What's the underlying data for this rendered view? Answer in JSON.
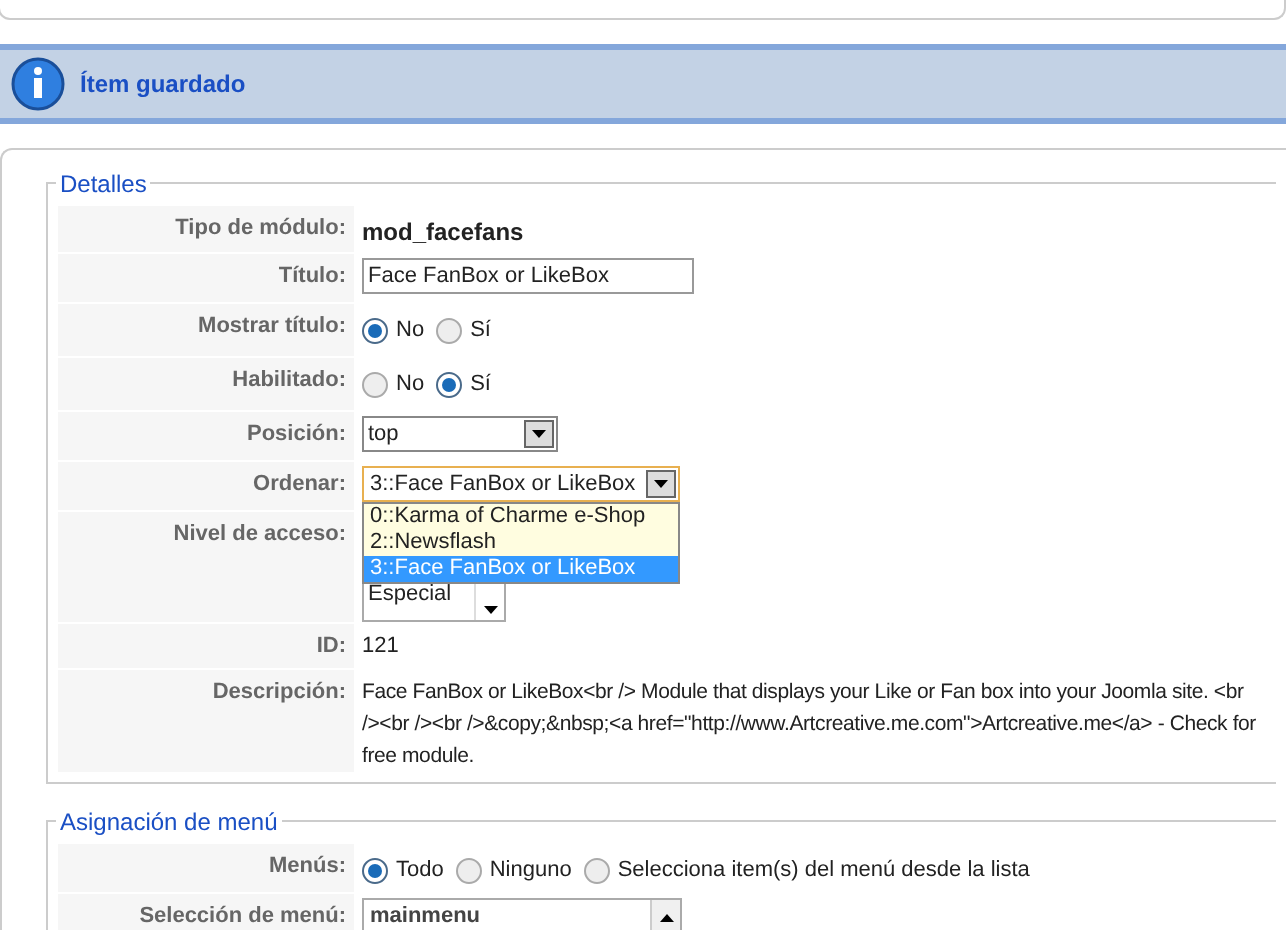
{
  "message": {
    "text": "Ítem guardado"
  },
  "details": {
    "legend": "Detalles",
    "module_type": {
      "label": "Tipo de módulo:",
      "value": "mod_facefans"
    },
    "title": {
      "label": "Título:",
      "value": "Face FanBox or LikeBox"
    },
    "show_title": {
      "label": "Mostrar título:",
      "options": [
        {
          "label": "No",
          "selected": true
        },
        {
          "label": "Sí",
          "selected": false
        }
      ]
    },
    "enabled": {
      "label": "Habilitado:",
      "options": [
        {
          "label": "No",
          "selected": false
        },
        {
          "label": "Sí",
          "selected": true
        }
      ]
    },
    "position": {
      "label": "Posición:",
      "value": "top"
    },
    "ordering": {
      "label": "Ordenar:",
      "value": "3::Face FanBox or LikeBox",
      "expanded": true,
      "options": [
        {
          "label": "0::Karma of Charme e-Shop",
          "selected": false
        },
        {
          "label": "2::Newsflash",
          "selected": false
        },
        {
          "label": "3::Face FanBox or LikeBox",
          "selected": true
        }
      ]
    },
    "access_level": {
      "label": "Nivel de acceso:",
      "visible_item": "Especial"
    },
    "id": {
      "label": "ID:",
      "value": "121"
    },
    "description": {
      "label": "Descripción:",
      "value": "Face FanBox or LikeBox<br /> Module that displays your Like or Fan box into your Joomla site. <br /><br /><br />&copy;&nbsp;<a href=\"http://www.Artcreative.me.com\">Artcreative.me</a> - Check for free module."
    }
  },
  "menu_assignment": {
    "legend": "Asignación de menú",
    "menus": {
      "label": "Menús:",
      "options": [
        {
          "label": "Todo",
          "selected": true
        },
        {
          "label": "Ninguno",
          "selected": false
        },
        {
          "label": "Selecciona item(s) del menú desde la lista",
          "selected": false
        }
      ]
    },
    "menu_selection": {
      "label": "Selección de menú:",
      "visible_item": "mainmenu"
    }
  }
}
